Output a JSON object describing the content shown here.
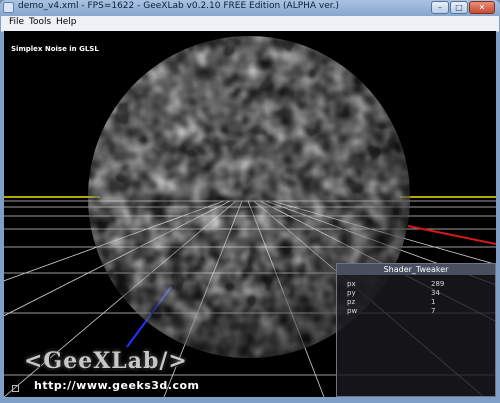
{
  "window": {
    "title": "demo_v4.xml - FPS=1622 - GeeXLab v0.2.10 FREE Edition (ALPHA ver.)",
    "controls": {
      "minimize": "–",
      "maximize": "□",
      "close": "✕"
    }
  },
  "menu": {
    "items": [
      "File",
      "Tools",
      "Help"
    ]
  },
  "scene": {
    "label": "Simplex Noise in GLSL"
  },
  "shader_tweaker": {
    "title": "Shader_Tweaker",
    "params": [
      {
        "name": "px",
        "value": "289"
      },
      {
        "name": "py",
        "value": "34"
      },
      {
        "name": "pz",
        "value": "1"
      },
      {
        "name": "pw",
        "value": "7"
      }
    ]
  },
  "branding": {
    "logo": "<GeeXLab/>",
    "url": "http://www.geeks3d.com"
  },
  "colors": {
    "title_bar": "#9db8da",
    "viewport_bg": "#000000",
    "grid": "#d9d9d9"
  }
}
